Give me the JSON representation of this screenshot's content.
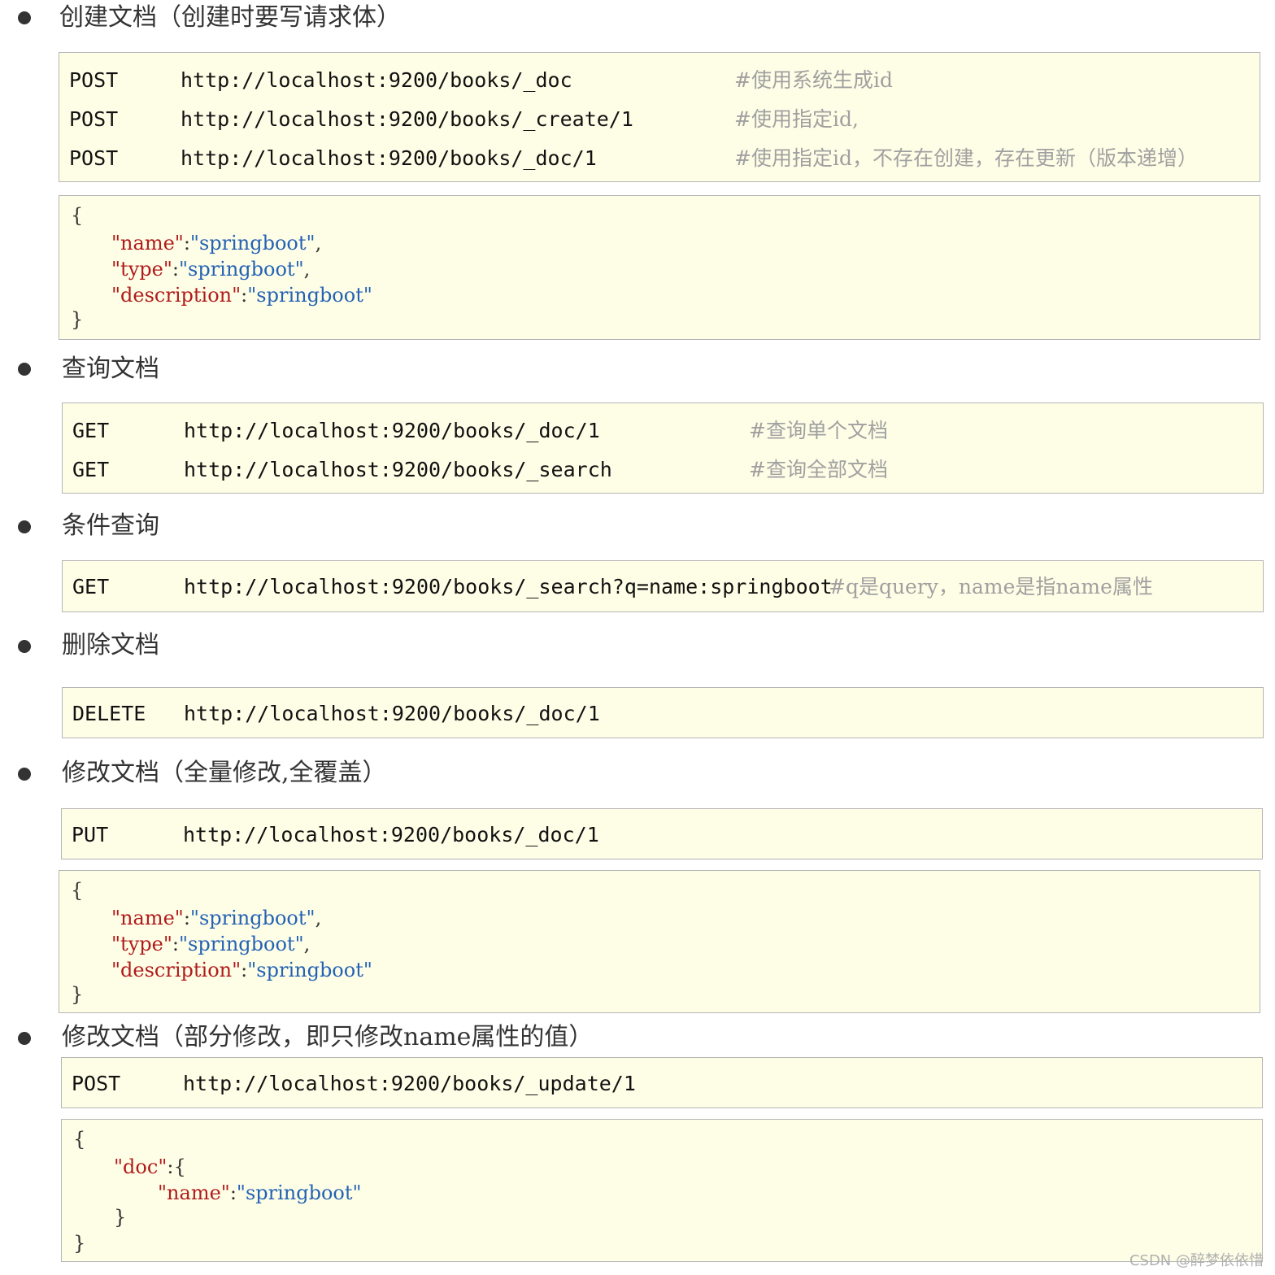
{
  "sections": {
    "create": {
      "title": "创建文档（创建时要写请求体）",
      "requests": [
        {
          "method": "POST",
          "url": "http://localhost:9200/books/_doc",
          "comment": "#使用系统生成id"
        },
        {
          "method": "POST",
          "url": "http://localhost:9200/books/_create/1",
          "comment": "#使用指定id,"
        },
        {
          "method": "POST",
          "url": "http://localhost:9200/books/_doc/1",
          "comment": "#使用指定id，不存在创建，存在更新（版本递增）"
        }
      ],
      "body": {
        "open": "{",
        "close": "}",
        "fields": [
          {
            "key": "name",
            "value": "springboot",
            "sep": ","
          },
          {
            "key": "type",
            "value": "springboot",
            "sep": ","
          },
          {
            "key": "description",
            "value": "springboot",
            "sep": ""
          }
        ]
      }
    },
    "query": {
      "title": "查询文档",
      "requests": [
        {
          "method": "GET",
          "url": "http://localhost:9200/books/_doc/1",
          "comment": "#查询单个文档"
        },
        {
          "method": "GET",
          "url": "http://localhost:9200/books/_search",
          "comment": "#查询全部文档"
        }
      ]
    },
    "conditional": {
      "title": "条件查询",
      "requests": [
        {
          "method": "GET",
          "url": "http://localhost:9200/books/_search?q=name:springboot",
          "comment": "#q是query，name是指name属性"
        }
      ]
    },
    "delete": {
      "title": "删除文档",
      "requests": [
        {
          "method": "DELETE",
          "url": "http://localhost:9200/books/_doc/1",
          "comment": ""
        }
      ]
    },
    "full_update": {
      "title": "修改文档（全量修改,全覆盖）",
      "requests": [
        {
          "method": "PUT",
          "url": "http://localhost:9200/books/_doc/1",
          "comment": ""
        }
      ],
      "body": {
        "open": "{",
        "close": "}",
        "fields": [
          {
            "key": "name",
            "value": "springboot",
            "sep": ","
          },
          {
            "key": "type",
            "value": "springboot",
            "sep": ","
          },
          {
            "key": "description",
            "value": "springboot",
            "sep": ""
          }
        ]
      }
    },
    "partial_update": {
      "title": "修改文档（部分修改，即只修改name属性的值）",
      "requests": [
        {
          "method": "POST",
          "url": "http://localhost:9200/books/_update/1",
          "comment": ""
        }
      ],
      "body": {
        "open": "{",
        "close": "}",
        "outer_key": "doc",
        "inner_open": "{",
        "inner_close": "}",
        "fields": [
          {
            "key": "name",
            "value": "springboot",
            "sep": ""
          }
        ]
      }
    }
  },
  "watermark": "CSDN @醉梦依依惜",
  "colors": {
    "box_background": "#fefee7",
    "box_border": "#b5b5b5",
    "json_key": "#b11b1b",
    "json_value": "#2462b4",
    "comment": "#a0a0a0"
  }
}
